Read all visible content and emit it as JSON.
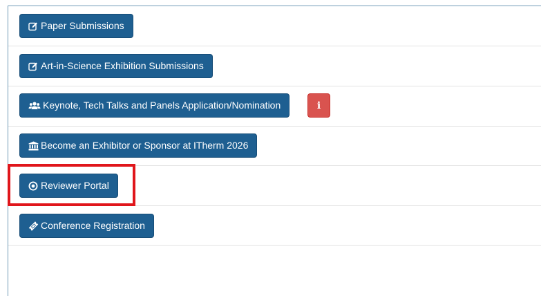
{
  "buttons": {
    "paper": {
      "label": "Paper Submissions",
      "icon": "edit-icon"
    },
    "art": {
      "label": "Art-in-Science Exhibition Submissions",
      "icon": "edit-icon"
    },
    "keynote": {
      "label": "Keynote, Tech Talks and Panels Application/Nomination",
      "icon": "users-icon"
    },
    "info": {
      "label": "i",
      "icon": "info-icon"
    },
    "exhibitor": {
      "label": "Become an Exhibitor or Sponsor at ITherm 2026",
      "icon": "bank-icon"
    },
    "reviewer": {
      "label": "Reviewer Portal",
      "icon": "dot-circle-icon"
    },
    "registration": {
      "label": "Conference Registration",
      "icon": "ticket-icon"
    }
  },
  "colors": {
    "primary": "#1e5f91",
    "danger": "#d9534f",
    "highlight": "#e0161b"
  }
}
